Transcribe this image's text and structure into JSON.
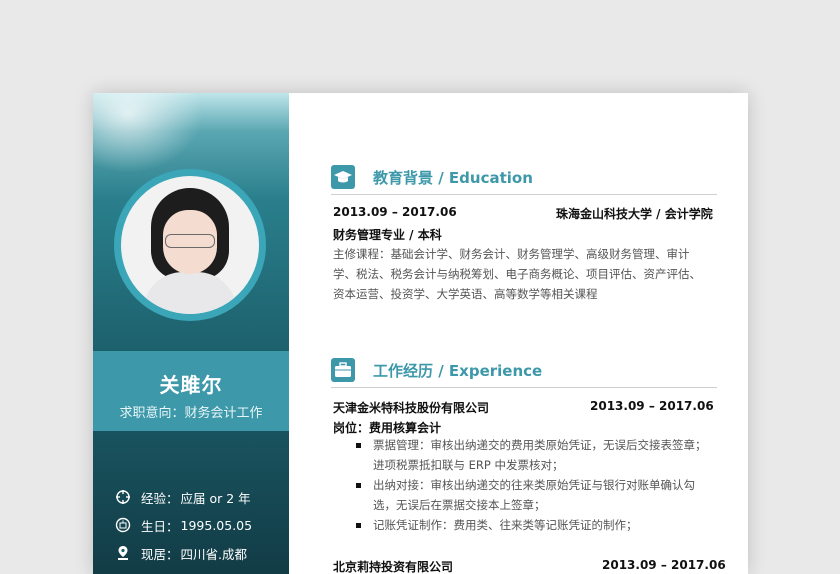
{
  "profile": {
    "name": "关雎尔",
    "objective": "求职意向：财务会计工作",
    "info": [
      {
        "icon": "crosshair-icon",
        "label": "经验：",
        "value": "应届 or 2 年"
      },
      {
        "icon": "birthday-icon",
        "label": "生日：",
        "value": "1995.05.05"
      },
      {
        "icon": "location-pin-icon",
        "label": "现居：",
        "value": "四川省.成都"
      }
    ]
  },
  "education": {
    "title": "教育背景 / Education",
    "period": "2013.09 – 2017.06",
    "school": "珠海金山科技大学 / 会计学院",
    "major": "财务管理专业 / 本科",
    "courses": [
      "主修课程：基础会计学、财务会计、财务管理学、高级财务管理、审计",
      "学、税法、税务会计与纳税筹划、电子商务概论、项目评估、资产评估、",
      "资本运营、投资学、大学英语、高等数学等相关课程"
    ]
  },
  "experience": {
    "title": "工作经历 / Experience",
    "jobs": [
      {
        "company": "天津金米特科技股份有限公司",
        "period": "2013.09 – 2017.06",
        "position": "岗位：费用核算会计",
        "lines": [
          "票据管理：审核出纳递交的费用类原始凭证，无误后交接表签章；",
          "进项税票抵扣联与 ERP 中发票核对；",
          "出纳对接：审核出纳递交的往来类原始凭证与银行对账单确认勾",
          "选，无误后在票据交接本上签章；",
          "记账凭证制作：费用类、往来类等记账凭证的制作；"
        ]
      },
      {
        "company": "北京莉持投资有限公司",
        "period": "2013.09 – 2017.06"
      }
    ]
  },
  "colors": {
    "accent": "#3d98aa",
    "sidebar_dark": "#123c46"
  }
}
